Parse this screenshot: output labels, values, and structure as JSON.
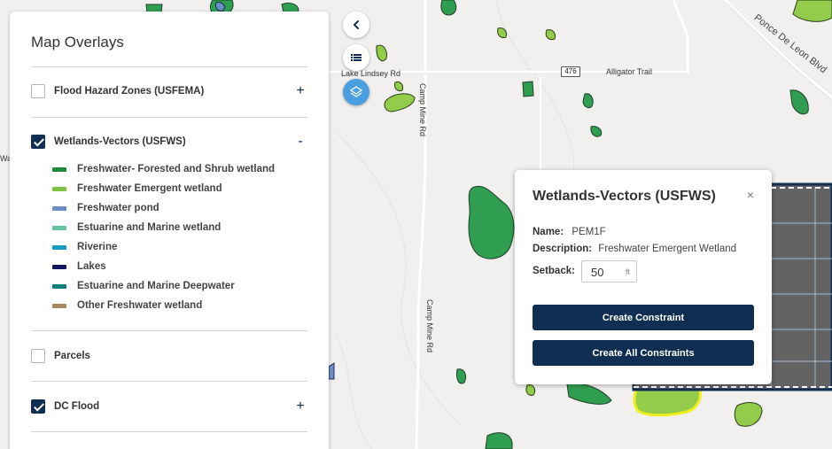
{
  "map": {
    "roads": {
      "lake_lindsey": "Lake Lindsey Rd",
      "alligator": "Alligator Trail",
      "route_shield": "476",
      "camp_mine_top": "Camp Mine Rd",
      "camp_mine_mid": "Camp Mine Rd",
      "ponce": "Ponce De Leon Blvd",
      "edge_fragment": "Wa"
    }
  },
  "controls": {
    "collapse_icon": "chevron-left-icon",
    "list_icon": "list-icon",
    "layers_icon": "layers-icon"
  },
  "panel": {
    "title": "Map Overlays",
    "layers": [
      {
        "label": "Flood Hazard Zones (USFEMA)",
        "checked": false,
        "toggle": "+"
      },
      {
        "label": "Wetlands-Vectors (USFWS)",
        "checked": true,
        "toggle": "-"
      },
      {
        "label": "Parcels",
        "checked": false
      },
      {
        "label": "DC Flood",
        "checked": true,
        "toggle": "+"
      }
    ],
    "legend": [
      {
        "label": "Freshwater- Forested and Shrub wetland",
        "color": "#1f8a3a"
      },
      {
        "label": "Freshwater Emergent wetland",
        "color": "#7ec242"
      },
      {
        "label": "Freshwater pond",
        "color": "#6b8fc7"
      },
      {
        "label": "Estuarine and Marine wetland",
        "color": "#66c2a5"
      },
      {
        "label": "Riverine",
        "color": "#1b9bc4"
      },
      {
        "label": "Lakes",
        "color": "#131560"
      },
      {
        "label": "Estuarine and Marine Deepwater",
        "color": "#0f7f7a"
      },
      {
        "label": "Other Freshwater wetland",
        "color": "#a6885a"
      }
    ]
  },
  "popup": {
    "title": "Wetlands-Vectors (USFWS)",
    "close": "×",
    "name_label": "Name:",
    "name_value": "PEM1F",
    "desc_label": "Description:",
    "desc_value": "Freshwater Emergent Wetland",
    "setback_label": "Setback:",
    "setback_value": "50",
    "setback_unit": "ft",
    "btn_constraint": "Create Constraint",
    "btn_all": "Create All Constraints"
  },
  "colors": {
    "navy": "#0f2e52",
    "accent_blue": "#4a9fe0",
    "wetland_green": "#2f9e51",
    "emergent_green": "#93cc4a",
    "selection_yellow": "#f0ee1c"
  }
}
